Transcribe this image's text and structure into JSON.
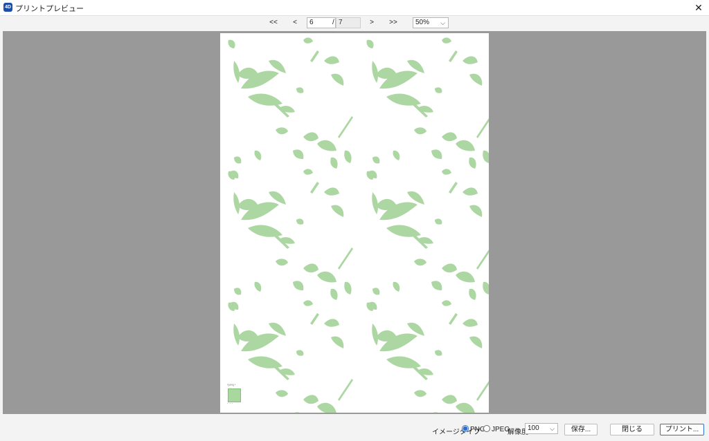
{
  "window": {
    "title": "プリントプレビュー",
    "app_icon_text": "4D",
    "close_glyph": "✕"
  },
  "nav": {
    "first": "<<",
    "prev": "<",
    "current_page": "6",
    "separator": "/",
    "total_pages": "7",
    "next": ">",
    "last": ">>",
    "zoom": "50%"
  },
  "preview": {
    "background_color": "#999999",
    "leaf_color": "#acd7a2",
    "thumb_label": "*[4%] *",
    "thumb_foot": "° ' ° ' ° "
  },
  "footer": {
    "image_type_label": "イメージタイプ",
    "png_label": "PNG",
    "png_selected": true,
    "jpeg_label": "JPEG",
    "jpeg_selected": false,
    "resolution_label": "解像度",
    "resolution_value": "100",
    "save_label": "保存...",
    "close_label": "閉じる",
    "print_label": "プリント..."
  }
}
